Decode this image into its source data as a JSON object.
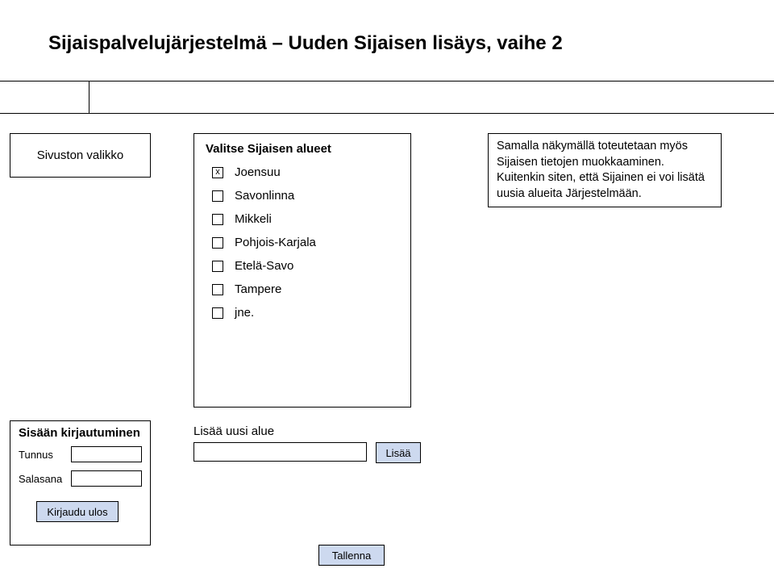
{
  "header": {
    "title": "Sijaispalvelujärjestelmä – Uuden Sijaisen lisäys, vaihe 2"
  },
  "sidebar": {
    "label": "Sivuston valikko"
  },
  "areas": {
    "title": "Valitse Sijaisen alueet",
    "items": [
      {
        "label": "Joensuu",
        "checked": true
      },
      {
        "label": "Savonlinna",
        "checked": false
      },
      {
        "label": "Mikkeli",
        "checked": false
      },
      {
        "label": "Pohjois-Karjala",
        "checked": false
      },
      {
        "label": "Etelä-Savo",
        "checked": false
      },
      {
        "label": "Tampere",
        "checked": false
      },
      {
        "label": "jne.",
        "checked": false
      }
    ]
  },
  "info": {
    "text": "Samalla näkymällä toteutetaan myös Sijaisen tietojen muokkaaminen. Kuitenkin siten, että Sijainen ei voi lisätä uusia alueita Järjestelmään."
  },
  "login": {
    "title": "Sisään kirjautuminen",
    "username_label": "Tunnus",
    "password_label": "Salasana",
    "logout_label": "Kirjaudu ulos"
  },
  "add_area": {
    "label": "Lisää uusi alue",
    "button": "Lisää"
  },
  "save": {
    "label": "Tallenna"
  }
}
